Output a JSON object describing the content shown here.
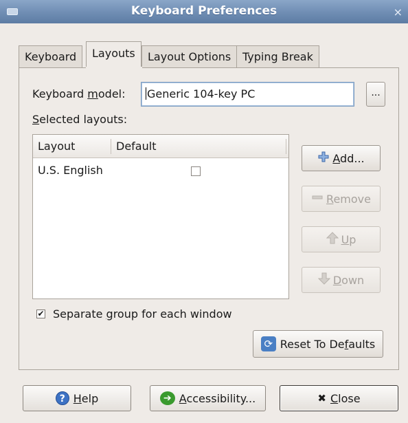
{
  "window": {
    "title": "Keyboard Preferences",
    "close_glyph": "×"
  },
  "tabs": [
    {
      "label": "Keyboard",
      "active": false
    },
    {
      "label": "Layouts",
      "active": true
    },
    {
      "label": "Layout Options",
      "active": false
    },
    {
      "label": "Typing Break",
      "active": false
    }
  ],
  "layouts_page": {
    "keyboard_model": {
      "label_pre": "Keyboard ",
      "label_mnemonic": "m",
      "label_post": "odel:",
      "value": "Generic 104-key PC",
      "browse_label": "..."
    },
    "selected_layouts": {
      "label_mnemonic": "S",
      "label_post": "elected layouts:"
    },
    "table": {
      "columns": [
        "Layout",
        "Default"
      ],
      "rows": [
        {
          "layout": "U.S. English",
          "default": false
        }
      ]
    },
    "buttons": {
      "add": {
        "icon": "add-icon",
        "mnemonic": "A",
        "label_post": "dd...",
        "enabled": true
      },
      "remove": {
        "icon": "remove-icon",
        "mnemonic": "R",
        "label_post": "emove",
        "enabled": false
      },
      "up": {
        "icon": "up-arrow-icon",
        "mnemonic": "U",
        "label_post": "p",
        "enabled": false
      },
      "down": {
        "icon": "down-arrow-icon",
        "mnemonic": "D",
        "label_post": "own",
        "enabled": false
      }
    },
    "separate_group": {
      "checked": true,
      "label_pre": "Separate ",
      "label_mnemonic": "g",
      "label_post": "roup for each window"
    },
    "reset": {
      "label_pre": "Reset To De",
      "label_mnemonic": "f",
      "label_post": "aults"
    }
  },
  "footer": {
    "help": {
      "mnemonic": "H",
      "label_post": "elp"
    },
    "accessibility": {
      "mnemonic": "A",
      "label_post": "ccessibility..."
    },
    "close": {
      "mnemonic": "C",
      "label_post": "lose",
      "icon_glyph": "✖"
    }
  },
  "colors": {
    "titlebar": "#6f8db3",
    "window_bg": "#efebe7",
    "entry_focus": "#7e9ec2"
  }
}
